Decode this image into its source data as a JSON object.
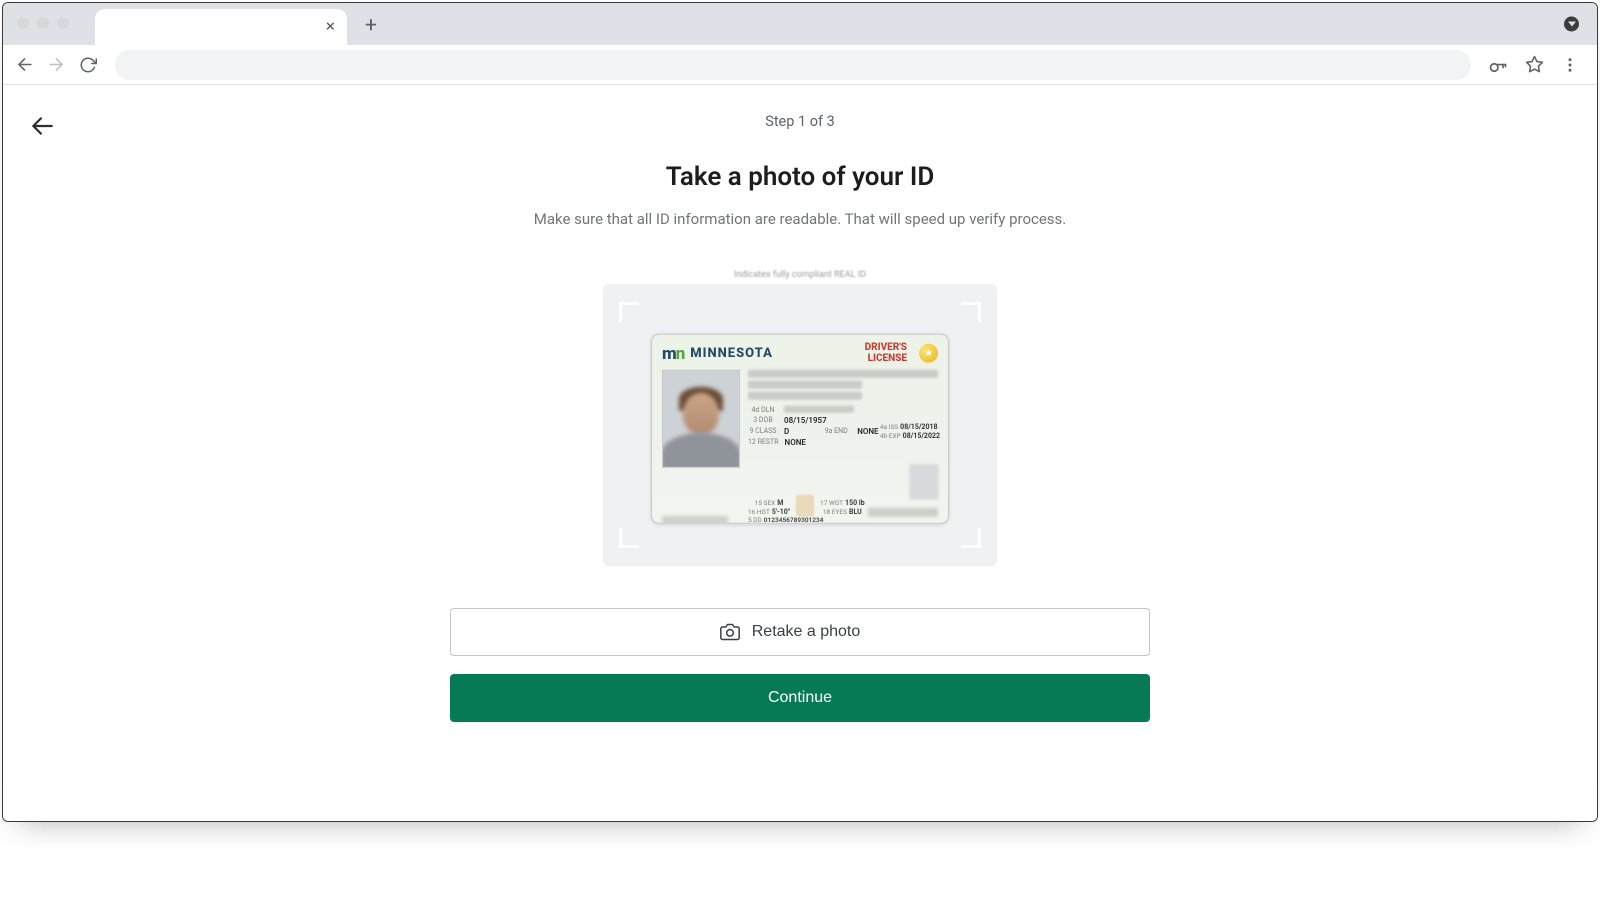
{
  "browser": {
    "tab_title": "",
    "close_glyph": "×",
    "plus_glyph": "+"
  },
  "page": {
    "step_label": "Step 1 of 3",
    "title": "Take a photo of your ID",
    "subtitle": "Make sure that all ID information are readable. That will speed up verify process."
  },
  "id_card": {
    "top_caption": "Indicates fully compliant REAL ID",
    "logo_m": "m",
    "logo_n": "n",
    "state": "MINNESOTA",
    "dl_line1": "DRIVER'S",
    "dl_line2": "LICENSE",
    "fields": {
      "dln_lab": "4d DLN",
      "dob_lab": "3  DOB",
      "dob": "08/15/1957",
      "class_lab": "9  CLASS",
      "class_val": "D",
      "end_lab": "9a END",
      "end_val": "NONE",
      "restr_lab": "12 RESTR",
      "restr_val": "NONE"
    },
    "dates": {
      "iss_lab": "4a ISS",
      "iss": "08/15/2018",
      "exp_lab": "4b EXP",
      "exp": "08/15/2022"
    },
    "bottom": {
      "sex_lab": "15 SEX",
      "sex_val": "M",
      "hgt_lab": "16 HGT",
      "hgt_val": "5'-10\"",
      "wgt_lab": "17 WGT",
      "wgt_val": "150 lb",
      "eyes_lab": "18 EYES",
      "eyes_val": "BLU",
      "dd_lab": "5  DD",
      "dd_val": "0123456789301234"
    }
  },
  "buttons": {
    "retake": "Retake a photo",
    "continue": "Continue"
  }
}
